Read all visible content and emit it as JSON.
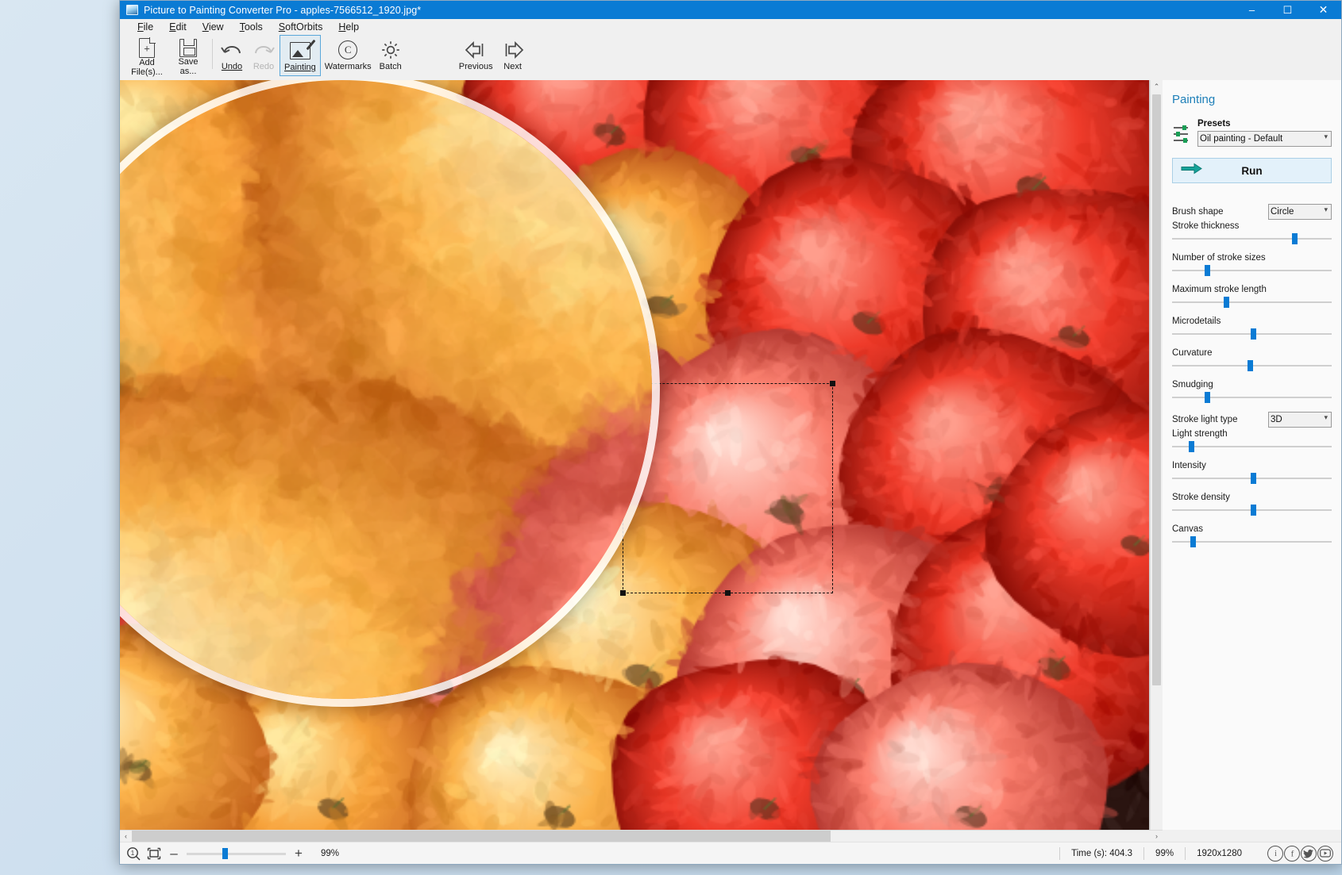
{
  "window": {
    "title": "Picture to Painting Converter Pro - apples-7566512_1920.jpg*",
    "icon": "app-icon",
    "minimize": "–",
    "maximize": "☐",
    "close": "✕"
  },
  "menubar": {
    "items": [
      {
        "label": "File",
        "mnemonic": "F"
      },
      {
        "label": "Edit",
        "mnemonic": "E"
      },
      {
        "label": "View",
        "mnemonic": "V"
      },
      {
        "label": "Tools",
        "mnemonic": "T"
      },
      {
        "label": "SoftOrbits",
        "mnemonic": "S"
      },
      {
        "label": "Help",
        "mnemonic": "H"
      }
    ]
  },
  "toolbar": {
    "buttons": [
      {
        "id": "add-files",
        "label_line1": "Add",
        "label_line2": "File(s)...",
        "icon": "document-add-icon",
        "state": "normal"
      },
      {
        "id": "save-as",
        "label_line1": "Save",
        "label_line2": "as...",
        "icon": "floppy-save-icon",
        "state": "normal"
      },
      {
        "id": "undo",
        "label_line1": "Undo",
        "label_line2": "",
        "icon": "undo-arrow-icon",
        "state": "normal"
      },
      {
        "id": "redo",
        "label_line1": "Redo",
        "label_line2": "",
        "icon": "redo-arrow-icon",
        "state": "disabled"
      },
      {
        "id": "painting",
        "label_line1": "Painting",
        "label_line2": "",
        "icon": "painting-icon",
        "state": "selected"
      },
      {
        "id": "watermarks",
        "label_line1": "Watermarks",
        "label_line2": "",
        "icon": "copyright-icon",
        "state": "normal"
      },
      {
        "id": "batch",
        "label_line1": "Batch",
        "label_line2": "",
        "icon": "gear-icon",
        "state": "normal"
      },
      {
        "id": "previous",
        "label_line1": "Previous",
        "label_line2": "",
        "icon": "arrow-left-icon",
        "state": "normal"
      },
      {
        "id": "next",
        "label_line1": "Next",
        "label_line2": "",
        "icon": "arrow-right-icon",
        "state": "normal"
      }
    ]
  },
  "panel": {
    "title": "Painting",
    "presets": {
      "caption": "Presets",
      "icon": "sliders-icon",
      "selected": "Oil painting - Default",
      "options": [
        "Oil painting - Default"
      ]
    },
    "run": {
      "label": "Run",
      "icon": "green-arrow-icon"
    },
    "brush_shape": {
      "label": "Brush shape",
      "selected": "Circle",
      "options": [
        "Circle"
      ]
    },
    "stroke_light_type": {
      "label": "Stroke light type",
      "selected": "3D",
      "options": [
        "3D"
      ]
    },
    "sliders": [
      {
        "label": "Stroke thickness",
        "percent": 77
      },
      {
        "label": "Number of stroke sizes",
        "percent": 22
      },
      {
        "label": "Maximum stroke length",
        "percent": 34
      },
      {
        "label": "Microdetails",
        "percent": 51
      },
      {
        "label": "Curvature",
        "percent": 49
      },
      {
        "label": "Smudging",
        "percent": 22
      },
      {
        "label": "Light strength",
        "percent": 12
      },
      {
        "label": "Intensity",
        "percent": 51
      },
      {
        "label": "Stroke density",
        "percent": 51
      },
      {
        "label": "Canvas",
        "percent": 13
      }
    ]
  },
  "canvas": {
    "scroll_left_arrow": "‹",
    "scroll_right_arrow": "›",
    "scroll_up_arrow": "⌃",
    "scroll_down_arrow": "⌄",
    "selection": "selection-marquee"
  },
  "statusbar": {
    "zoom_in_icon": "magnifier-one-to-one-icon",
    "fit_icon": "fit-to-window-icon",
    "minus": "–",
    "plus": "+",
    "zoom_slider_percent": 99,
    "zoom_label": "99%",
    "time": "Time (s): 404.3",
    "zoom_right": "99%",
    "dimensions": "1920x1280",
    "social": [
      {
        "id": "info",
        "icon": "info-icon",
        "glyph": "i"
      },
      {
        "id": "facebook",
        "icon": "facebook-icon",
        "glyph": "f"
      },
      {
        "id": "twitter",
        "icon": "twitter-icon",
        "glyph": "ᴠ"
      },
      {
        "id": "youtube",
        "icon": "youtube-icon",
        "glyph": "▶"
      }
    ]
  },
  "colors": {
    "titlebar": "#0a7bd4",
    "accent": "#0a7bd4",
    "panel_title": "#1d7fb8",
    "run_bg": "#e3f1fa",
    "run_border": "#aacfe6",
    "green_arrow": "#0f9b8e"
  }
}
